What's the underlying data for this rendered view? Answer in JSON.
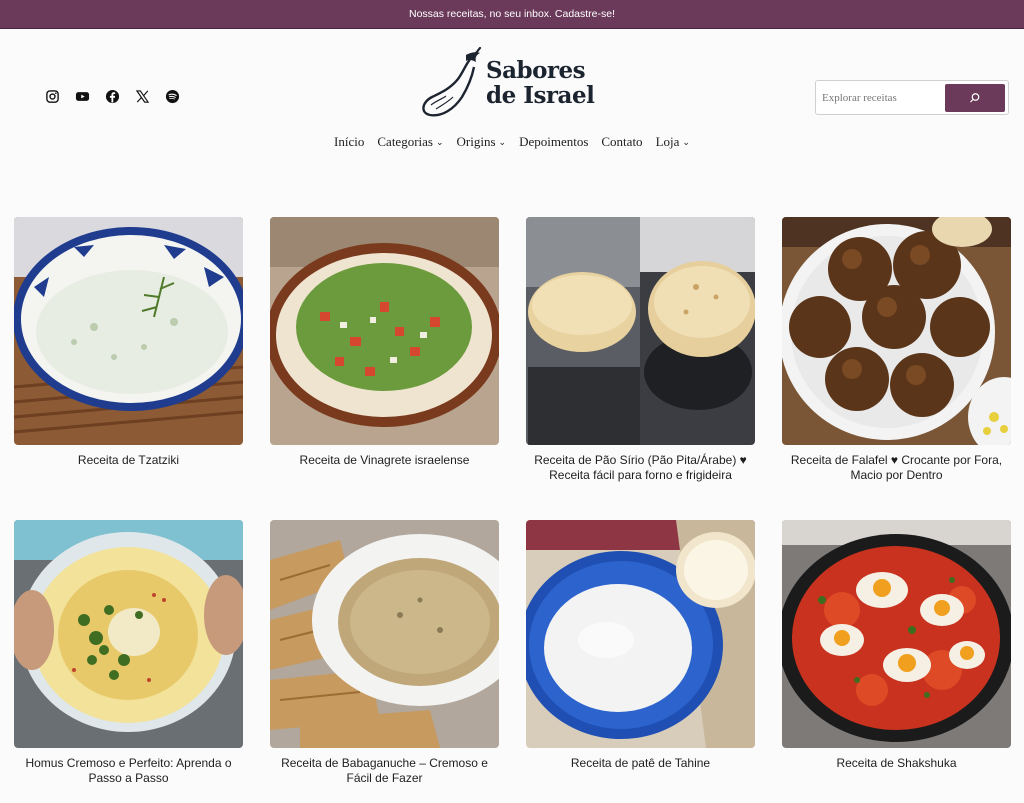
{
  "announcement": {
    "text": "Nossas receitas, no seu inbox. Cadastre-se!"
  },
  "header": {
    "logo_line1": "Sabores",
    "logo_line2": "de Israel",
    "social": [
      {
        "name": "instagram-icon"
      },
      {
        "name": "youtube-icon"
      },
      {
        "name": "facebook-icon"
      },
      {
        "name": "x-icon"
      },
      {
        "name": "spotify-icon"
      }
    ],
    "search": {
      "placeholder": "Explorar receitas",
      "button_icon": "search-icon"
    }
  },
  "nav": {
    "items": [
      {
        "label": "Início",
        "dropdown": false
      },
      {
        "label": "Categorias",
        "dropdown": true
      },
      {
        "label": "Origins",
        "dropdown": true
      },
      {
        "label": "Depoimentos",
        "dropdown": false
      },
      {
        "label": "Contato",
        "dropdown": false
      },
      {
        "label": "Loja",
        "dropdown": true
      }
    ]
  },
  "colors": {
    "brand": "#6b3a5a",
    "text": "#1e1e1e",
    "logo": "#1c2430"
  },
  "recipes": [
    {
      "title": "Receita de Tzatziki"
    },
    {
      "title": "Receita de Vinagrete israelense"
    },
    {
      "title": "Receita de Pão Sírio (Pão Pita/Árabe) ♥ Receita fácil para forno e frigideira"
    },
    {
      "title": "Receita de Falafel ♥ Crocante por Fora, Macio por Dentro"
    },
    {
      "title": "Homus Cremoso e Perfeito: Aprenda o Passo a Passo"
    },
    {
      "title": "Receita de Babaganuche – Cremoso e Fácil de Fazer"
    },
    {
      "title": "Receita de patê de Tahine"
    },
    {
      "title": "Receita de Shakshuka"
    }
  ]
}
